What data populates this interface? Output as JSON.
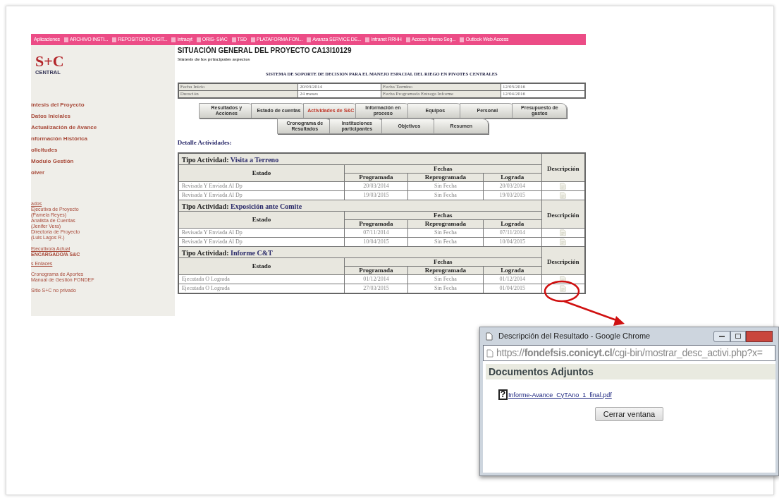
{
  "bookmarks": [
    "Aplicaciones",
    "ARCHIVO INSTI...",
    "REPOSITORIO DIGIT...",
    "Intracyt",
    "ORIS- SIAC",
    "TSD",
    "PLATAFORMA FON...",
    "Avanza SERVICE DE...",
    "Intranet RRHH",
    "Acceso Interno Seg...",
    "Outlook Web Access"
  ],
  "logo": {
    "text": "S+C",
    "subtext": "CENTRAL"
  },
  "sidebar": {
    "items": [
      "íntesis del Proyecto",
      "Datos Iniciales",
      "Actualización de Avance",
      "nformación Histórica",
      "olicitudes",
      "Modulo Gestión",
      "olver"
    ],
    "contacts_heading": "ados",
    "contacts": [
      "Ejecutiva de Proyecto",
      "(Pamela Reyes)",
      "Analista de Cuentas",
      "(Jenifer Vera)",
      "Directoria de Proyecto",
      "(Luis Lagos R.)"
    ],
    "encargado_heading": "Ejecutivo/a Actual",
    "encargado": "ENCARGADO/A S&C",
    "links_heading": "s Enlaces",
    "links": [
      "Cronograma de Aportes",
      "Manual de Gestión FONDEF"
    ],
    "footer_link": "Sitio S+C no privado"
  },
  "page": {
    "title": "SITUACIÓN GENERAL DEL PROYECTO CA13I10129",
    "subtitle": "Síntesis de los principales aspectos",
    "project_name": "SISTEMA DE SOPORTE DE DECISION PARA EL MANEJO ESPACIAL DEL RIEGO EN PIVOTES CENTRALES"
  },
  "info_rows": [
    [
      "Fecha Inicio",
      "20/03/2014",
      "Fecha Termino",
      "12/03/2016"
    ],
    [
      "Duración",
      "24 meses",
      "Fecha Programada Entrega Informe",
      "12/04/2016"
    ]
  ],
  "tab_rows": [
    [
      {
        "label": "Resultados y Acciones",
        "selected": false
      },
      {
        "label": "Estado de cuentas",
        "selected": false
      },
      {
        "label": "Actividades de S&C",
        "selected": true
      },
      {
        "label": "Información en proceso",
        "selected": false
      },
      {
        "label": "Equipos",
        "selected": false
      },
      {
        "label": "Personal",
        "selected": false
      },
      {
        "label": "Presupuesto de gastos",
        "selected": false
      }
    ],
    [
      {
        "label": "Cronograma de Resultados",
        "selected": false
      },
      {
        "label": "Instituciones participantes",
        "selected": false
      },
      {
        "label": "Objetivos",
        "selected": false
      },
      {
        "label": "Resumen",
        "selected": false
      }
    ]
  ],
  "detail_heading": "Detalle Actividades:",
  "activity_groups": [
    {
      "type_label": "Tipo Actividad:",
      "type": "Visita a Terreno",
      "headers": {
        "estado": "Estado",
        "fechas": "Fechas",
        "programada": "Programada",
        "reprogramada": "Reprogramada",
        "lograda": "Lograda",
        "descripcion": "Descripción"
      },
      "rows": [
        [
          "Revisada Y Enviada Al Dp",
          "20/03/2014",
          "Sin Fecha",
          "20/03/2014"
        ],
        [
          "Revisada Y Enviada Al Dp",
          "19/03/2015",
          "Sin Fecha",
          "19/03/2015"
        ]
      ]
    },
    {
      "type_label": "Tipo Actividad:",
      "type": "Exposición ante Comite",
      "headers": {
        "estado": "Estado",
        "fechas": "Fechas",
        "programada": "Programada",
        "reprogramada": "Reprogramada",
        "lograda": "Lograda",
        "descripcion": "Descripción"
      },
      "rows": [
        [
          "Revisada Y Enviada Al Dp",
          "07/11/2014",
          "Sin Fecha",
          "07/11/2014"
        ],
        [
          "Revisada Y Enviada Al Dp",
          "10/04/2015",
          "Sin Fecha",
          "10/04/2015"
        ]
      ]
    },
    {
      "type_label": "Tipo Actividad:",
      "type": "Informe C&T",
      "headers": {
        "estado": "Estado",
        "fechas": "Fechas",
        "programada": "Programada",
        "reprogramada": "Reprogramada",
        "lograda": "Lograda",
        "descripcion": "Descripción"
      },
      "rows": [
        [
          "Ejecutada O Lograda",
          "01/12/2014",
          "Sin Fecha",
          "01/12/2014"
        ],
        [
          "Ejecutada O Lograda",
          "27/03/2015",
          "Sin Fecha",
          "01/04/2015"
        ]
      ]
    }
  ],
  "popup": {
    "title": "Descripción del Resultado - Google Chrome",
    "url": "https://**fondefsis.conicyt.cl**/cgi-bin/mostrar_desc_activi.php?x=",
    "heading": "Documentos Adjuntos",
    "file_icon": "?",
    "file": "Informe-Avance_CyTAno_1_final.pdf",
    "button": "Cerrar ventana"
  }
}
